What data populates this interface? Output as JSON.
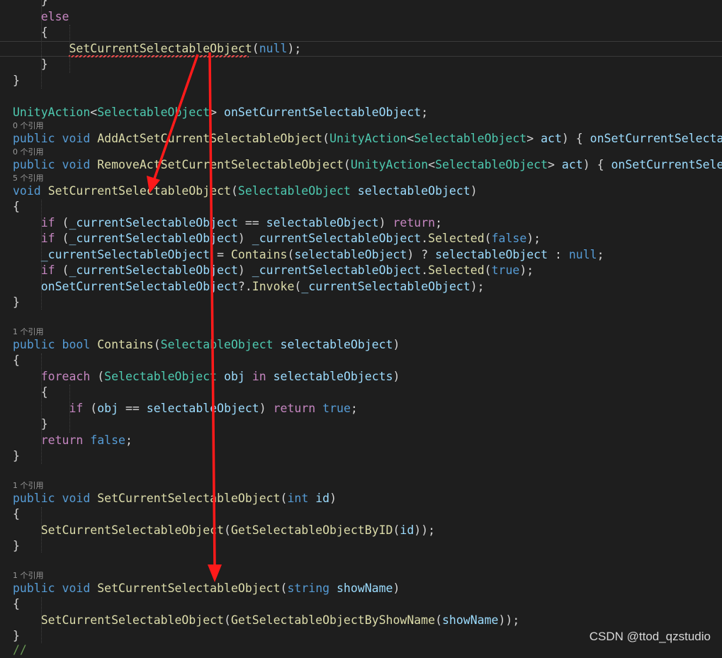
{
  "code_lines": [
    [
      "    }"
    ],
    [
      "    ",
      [
        "ctl",
        "else"
      ]
    ],
    [
      "    {"
    ],
    [
      "        ",
      [
        "fn",
        "SetCurrentSelectableObject"
      ],
      "(",
      [
        "lit",
        "null"
      ],
      ");"
    ],
    [
      "    }"
    ],
    [
      "}"
    ],
    [
      ""
    ],
    [
      [
        "ty",
        "UnityAction"
      ],
      "<",
      [
        "ty",
        "SelectableObject"
      ],
      "> ",
      [
        "var",
        "onSetCurrentSelectableObject"
      ],
      ";"
    ],
    [
      [
        "kw",
        "public"
      ],
      " ",
      [
        "kw",
        "void"
      ],
      " ",
      [
        "fn",
        "AddActSetCurrentSelectableObject"
      ],
      "(",
      [
        "ty",
        "UnityAction"
      ],
      "<",
      [
        "ty",
        "SelectableObject"
      ],
      "> ",
      [
        "var",
        "act"
      ],
      ") { ",
      [
        "var",
        "onSetCurrentSelectab"
      ]
    ],
    [
      [
        "kw",
        "public"
      ],
      " ",
      [
        "kw",
        "void"
      ],
      " ",
      [
        "fn",
        "RemoveActSetCurrentSelectableObject"
      ],
      "(",
      [
        "ty",
        "UnityAction"
      ],
      "<",
      [
        "ty",
        "SelectableObject"
      ],
      "> ",
      [
        "var",
        "act"
      ],
      ") { ",
      [
        "var",
        "onSetCurrentSelec"
      ]
    ],
    [
      [
        "kw",
        "void"
      ],
      " ",
      [
        "fn",
        "SetCurrentSelectableObject"
      ],
      "(",
      [
        "ty",
        "SelectableObject"
      ],
      " ",
      [
        "var",
        "selectableObject"
      ],
      ")"
    ],
    [
      "{"
    ],
    [
      "    ",
      [
        "ctl",
        "if"
      ],
      " (",
      [
        "var",
        "_currentSelectableObject"
      ],
      " == ",
      [
        "var",
        "selectableObject"
      ],
      ") ",
      [
        "ctl",
        "return"
      ],
      ";"
    ],
    [
      "    ",
      [
        "ctl",
        "if"
      ],
      " (",
      [
        "var",
        "_currentSelectableObject"
      ],
      ") ",
      [
        "var",
        "_currentSelectableObject"
      ],
      ".",
      [
        "fn",
        "Selected"
      ],
      "(",
      [
        "lit",
        "false"
      ],
      ");"
    ],
    [
      "    ",
      [
        "var",
        "_currentSelectableObject"
      ],
      " = ",
      [
        "fn",
        "Contains"
      ],
      "(",
      [
        "var",
        "selectableObject"
      ],
      ") ? ",
      [
        "var",
        "selectableObject"
      ],
      " : ",
      [
        "lit",
        "null"
      ],
      ";"
    ],
    [
      "    ",
      [
        "ctl",
        "if"
      ],
      " (",
      [
        "var",
        "_currentSelectableObject"
      ],
      ") ",
      [
        "var",
        "_currentSelectableObject"
      ],
      ".",
      [
        "fn",
        "Selected"
      ],
      "(",
      [
        "lit",
        "true"
      ],
      ");"
    ],
    [
      "    ",
      [
        "var",
        "onSetCurrentSelectableObject"
      ],
      "?.",
      [
        "fn",
        "Invoke"
      ],
      "(",
      [
        "var",
        "_currentSelectableObject"
      ],
      ");"
    ],
    [
      "}"
    ],
    [
      ""
    ],
    [
      [
        "kw",
        "public"
      ],
      " ",
      [
        "kw",
        "bool"
      ],
      " ",
      [
        "fn",
        "Contains"
      ],
      "(",
      [
        "ty",
        "SelectableObject"
      ],
      " ",
      [
        "var",
        "selectableObject"
      ],
      ")"
    ],
    [
      "{"
    ],
    [
      "    ",
      [
        "ctl",
        "foreach"
      ],
      " (",
      [
        "ty",
        "SelectableObject"
      ],
      " ",
      [
        "var",
        "obj"
      ],
      " ",
      [
        "ctl",
        "in"
      ],
      " ",
      [
        "var",
        "selectableObjects"
      ],
      ")"
    ],
    [
      "    {"
    ],
    [
      "        ",
      [
        "ctl",
        "if"
      ],
      " (",
      [
        "var",
        "obj"
      ],
      " == ",
      [
        "var",
        "selectableObject"
      ],
      ") ",
      [
        "ctl",
        "return"
      ],
      " ",
      [
        "lit",
        "true"
      ],
      ";"
    ],
    [
      "    }"
    ],
    [
      "    ",
      [
        "ctl",
        "return"
      ],
      " ",
      [
        "lit",
        "false"
      ],
      ";"
    ],
    [
      "}"
    ],
    [
      ""
    ],
    [
      [
        "kw",
        "public"
      ],
      " ",
      [
        "kw",
        "void"
      ],
      " ",
      [
        "fn",
        "SetCurrentSelectableObject"
      ],
      "(",
      [
        "kw",
        "int"
      ],
      " ",
      [
        "var",
        "id"
      ],
      ")"
    ],
    [
      "{"
    ],
    [
      "    ",
      [
        "fn",
        "SetCurrentSelectableObject"
      ],
      "(",
      [
        "fn",
        "GetSelectableObjectByID"
      ],
      "(",
      [
        "var",
        "id"
      ],
      "));"
    ],
    [
      "}"
    ],
    [
      ""
    ],
    [
      [
        "kw",
        "public"
      ],
      " ",
      [
        "kw",
        "void"
      ],
      " ",
      [
        "fn",
        "SetCurrentSelectableObject"
      ],
      "(",
      [
        "kw",
        "string"
      ],
      " ",
      [
        "var",
        "showName"
      ],
      ")"
    ],
    [
      "{"
    ],
    [
      "    ",
      [
        "fn",
        "SetCurrentSelectableObject"
      ],
      "(",
      [
        "fn",
        "GetSelectableObjectByShowName"
      ],
      "(",
      [
        "var",
        "showName"
      ],
      "));"
    ],
    [
      "}"
    ],
    [
      [
        "cm",
        "//"
      ]
    ]
  ],
  "codelens": [
    "0 个引用",
    "0 个引用",
    "5 个引用",
    "1 个引用",
    "1 个引用",
    "1 个引用"
  ],
  "watermark": "CSDN @ttod_qzstudio",
  "colors": {
    "background": "#1e1e1e",
    "keyword": "#569cd6",
    "control": "#c586c0",
    "type": "#4ec9b0",
    "function": "#dcdcaa",
    "variable": "#9cdcfe",
    "text": "#d4d4d4",
    "annotation_arrow": "#ff1a1a",
    "error_squiggle": "#f14c4c"
  }
}
